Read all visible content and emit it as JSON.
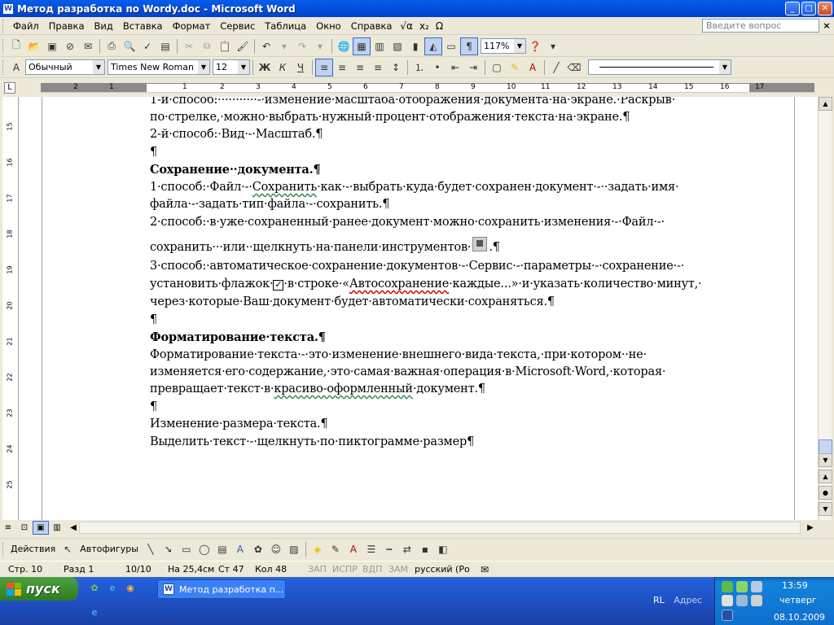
{
  "window": {
    "title": "Метод разработка по Wordy.doc - Microsoft Word",
    "app_icon": "W",
    "minimize": "_",
    "maximize": "□",
    "close": "✕"
  },
  "menu": {
    "items": [
      "Файл",
      "Правка",
      "Вид",
      "Вставка",
      "Формат",
      "Сервис",
      "Таблица",
      "Окно",
      "Справка"
    ],
    "glyphs": [
      "√α",
      "x₂",
      "Ω"
    ],
    "help_placeholder": "Введите вопрос",
    "close": "×"
  },
  "toolbar_standard": {
    "zoom": "117%",
    "icons": [
      "new-icon",
      "open-icon",
      "save-icon",
      "permission-icon",
      "print-icon",
      "print-preview-icon",
      "spelling-icon",
      "cut-icon",
      "copy-icon",
      "paste-icon",
      "format-painter-icon",
      "undo-icon",
      "redo-icon",
      "hyperlink-icon",
      "tables-borders-icon",
      "insert-table-icon",
      "insert-excel-icon",
      "columns-icon",
      "drawing-icon",
      "document-map-icon",
      "show-hide-icon",
      "help-icon"
    ]
  },
  "toolbar_formatting": {
    "style": "Обычный",
    "font": "Times New Roman",
    "size": "12",
    "bold": "Ж",
    "italic": "К",
    "underline": "Ч"
  },
  "ruler": {
    "corner": "L",
    "numbers": [
      "2",
      "1",
      "1",
      "2",
      "3",
      "4",
      "5",
      "6",
      "7",
      "8",
      "9",
      "10",
      "11",
      "12",
      "13",
      "14",
      "15",
      "16",
      "17"
    ],
    "vertical_numbers": [
      "15",
      "16",
      "17",
      "18",
      "19",
      "20",
      "21",
      "22",
      "23",
      "24",
      "25"
    ]
  },
  "document": {
    "lines": {
      "l1": "1-й·способ:···········-·изменение·масштаба·отображения·документа·на·экране.·Раскрыв·",
      "l2": "по·стрелке,·можно·выбрать·нужный·процент·отображения·текста·на·экране.¶",
      "l3": "2-й·способ:·Вид·-·Масштаб.¶",
      "l4": "¶",
      "l5": "Сохранение··документа.¶",
      "l6a": "1·способ:·Файл·-·",
      "l6b": "Сохранить",
      "l6c": "·как·-·выбрать·куда·будет·сохранен·документ·-··задать·имя·",
      "l7": "файла·-·задать·тип·файла·-·сохранить.¶",
      "l8": "2·способ:·в·уже·сохраненный·ранее·документ·можно·сохранить·изменения·-·Файл·-·",
      "l9a": "сохранить···или··щелкнуть·на·панели·инструментов·",
      "l9b": ".¶",
      "l10": "3·способ:·автоматическое·сохранение·документов·-·Сервис·-·параметры·-·сохранение·-·",
      "l11a": "установить·флажок·",
      "l11b": "·в·строке·«",
      "l11c": "Автосохранение",
      "l11d": "·каждые...»·и·указать·количество·минут,·",
      "l12": "через·которые·Ваш·документ·будет·автоматически·сохраняться.¶",
      "l13": "¶",
      "l14": "Форматирование·текста.¶",
      "l15": "Форматирование·текста·-·это·изменение·внешнего·вида·текста,·при·котором··не·",
      "l16": "изменяется·его·содержание,·это·самая·важная·операция·в·Microsoft·Word,·которая·",
      "l17a": "превращает·текст·в·",
      "l17b": "красиво-оформленный",
      "l17c": "·документ.¶",
      "l18": "¶",
      "l19": "Изменение·размера·текста.¶",
      "l20": "Выделить·текст·-·щелкнуть·по·пиктограмме·размер¶"
    }
  },
  "drawing_toolbar": {
    "actions": "Действия",
    "autoshapes": "Автофигуры"
  },
  "status": {
    "page": "Стр.  10",
    "section": "Разд  1",
    "pages": "10/10",
    "at": "На 25,4см",
    "line": "Ст  47",
    "col": "Кол  48",
    "rec": "ЗАП",
    "trk": "ИСПР",
    "ext": "ВДП",
    "ovr": "ЗАМ",
    "lang": "русский (Ро"
  },
  "taskbar": {
    "start": "пуск",
    "task_label": "Метод разработка п...",
    "lang": "RL",
    "address": "Адрес",
    "time": "13:59",
    "day": "четверг",
    "date": "08.10.2009"
  },
  "colors": {
    "title_blue": "#0352e0",
    "start_green": "#3c8f2f",
    "tray_blue": "#1383d9"
  }
}
